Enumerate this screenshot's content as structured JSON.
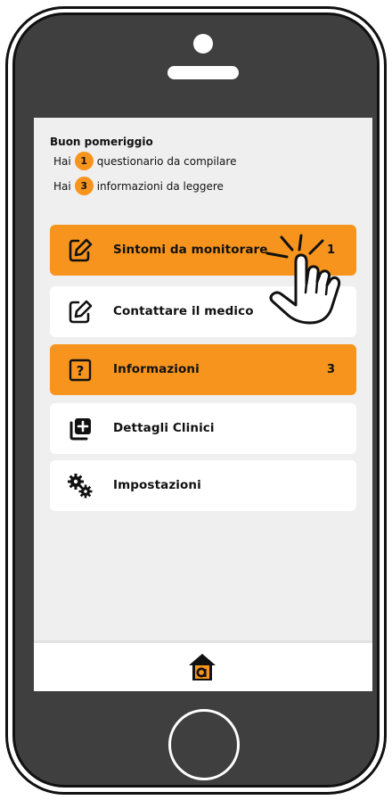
{
  "header": {
    "greeting": "Buon pomeriggio",
    "notices": [
      {
        "prefix": "Hai",
        "count": "1",
        "text": "questionario da compilare"
      },
      {
        "prefix": "Hai",
        "count": "3",
        "text": "informazioni da leggere"
      }
    ]
  },
  "menu": [
    {
      "label": "Sintomi da monitorare",
      "count": "1",
      "icon": "edit-icon",
      "active": true
    },
    {
      "label": "Contattare il medico",
      "count": "",
      "icon": "edit-icon",
      "active": false
    },
    {
      "label": "Informazioni",
      "count": "3",
      "icon": "question-box-icon",
      "active": true
    },
    {
      "label": "Dettagli Clinici",
      "count": "",
      "icon": "add-copy-icon",
      "active": false
    },
    {
      "label": "Impostazioni",
      "count": "",
      "icon": "gears-icon",
      "active": false
    }
  ],
  "bottom_nav": {
    "icon": "home-logo-icon"
  },
  "colors": {
    "accent": "#f7941d",
    "frame": "#3f3f3f",
    "screen_bg": "#efefef"
  }
}
